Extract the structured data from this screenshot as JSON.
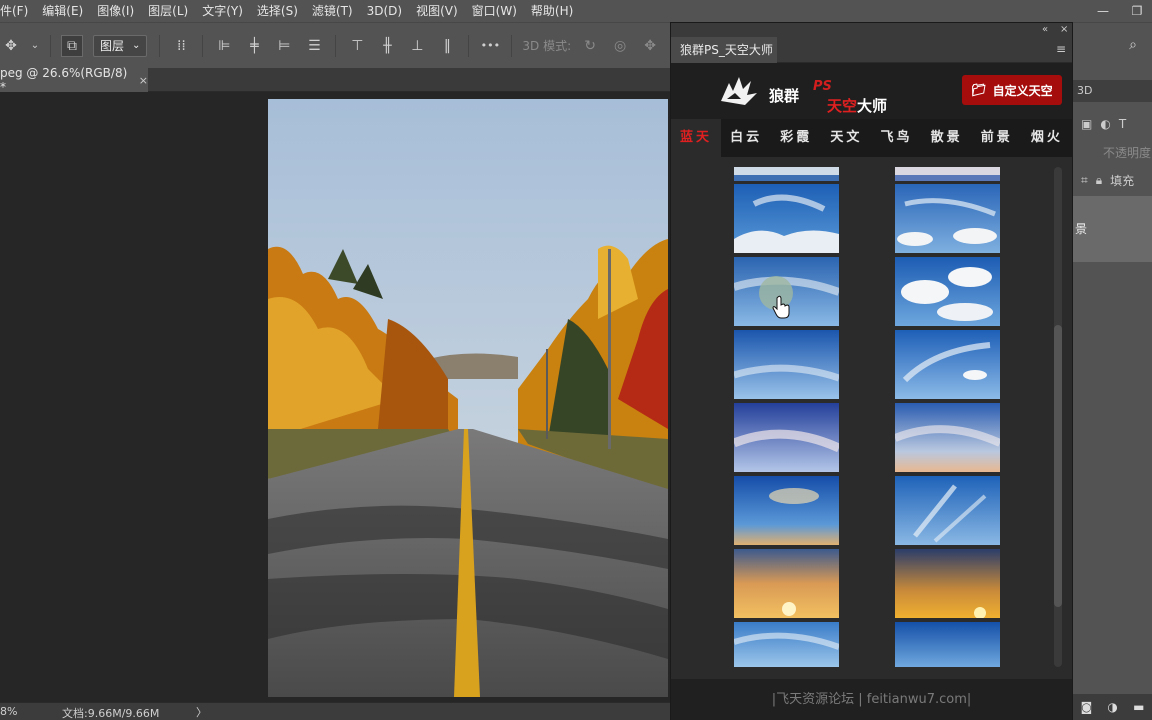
{
  "menubar": {
    "items": [
      "件(F)",
      "编辑(E)",
      "图像(I)",
      "图层(L)",
      "文字(Y)",
      "选择(S)",
      "滤镜(T)",
      "3D(D)",
      "视图(V)",
      "窗口(W)",
      "帮助(H)"
    ],
    "window_controls": {
      "minimize": "—",
      "restore": "❐"
    }
  },
  "options_bar": {
    "layer_select": "图层",
    "mode_label": "3D 模式:",
    "more": "•••"
  },
  "document_tab": {
    "title": "peg @ 26.6%(RGB/8) *",
    "close": "×"
  },
  "status_bar": {
    "zoom": "8%",
    "doc_info": "文档:9.66M/9.66M",
    "arrow": "〉"
  },
  "right_panel": {
    "tab_label": "3D",
    "opacity_label": "不透明度",
    "fill_label": "填充",
    "layer_label": "景"
  },
  "plugin": {
    "tab_title": "狼群PS_天空大师",
    "collapse": "«",
    "close": "×",
    "menu": "≡",
    "logo": {
      "text_a": "狼群",
      "text_b": "PS",
      "text_c_red": "天空",
      "text_c_white": "大师"
    },
    "custom_button": "自定义天空",
    "categories": [
      "蓝天",
      "白云",
      "彩霞",
      "天文",
      "飞鸟",
      "散景",
      "前景",
      "烟火"
    ],
    "active_category": "蓝天",
    "footer": "|飞天资源论坛 | feitianwu7.com|"
  },
  "colors": {
    "accent_red": "#a50c0c",
    "active_red": "#e02020",
    "menubar_bg": "#535353"
  }
}
